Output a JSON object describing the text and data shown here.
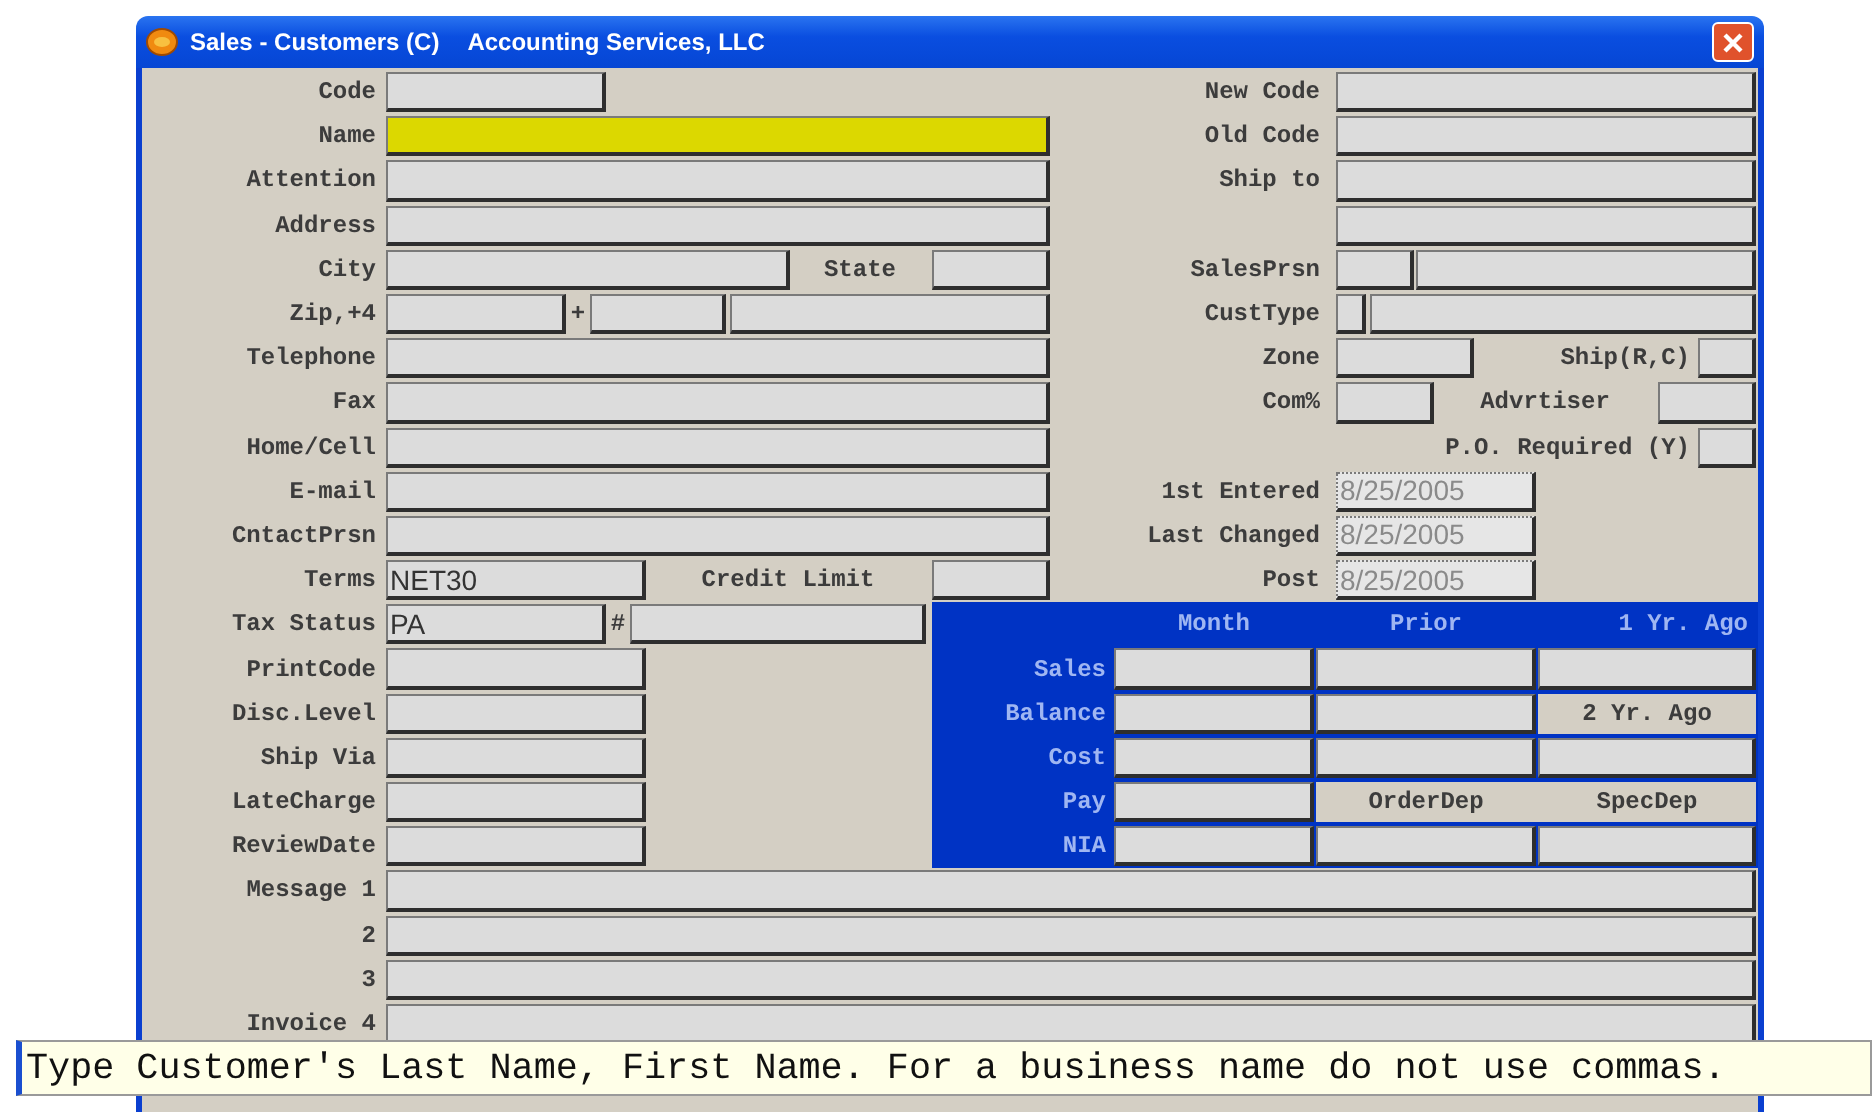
{
  "window": {
    "title": "Sales - Customers (C)",
    "company": "Accounting Services, LLC"
  },
  "left_column": [
    {
      "label": "Code",
      "focused": false
    },
    {
      "label": "Name",
      "focused": true
    },
    {
      "label": "Attention",
      "focused": false
    },
    {
      "label": "Address",
      "focused": false
    },
    {
      "label": "City",
      "extra_label": "State",
      "focused": false
    },
    {
      "label": "Zip,+4",
      "extra_label": "+",
      "focused": false
    },
    {
      "label": "Telephone",
      "focused": false
    },
    {
      "label": "Fax",
      "focused": false
    },
    {
      "label": "Home/Cell",
      "focused": false
    },
    {
      "label": "E-mail",
      "focused": false
    },
    {
      "label": "CntactPrsn",
      "focused": false
    },
    {
      "label": "Terms",
      "value": "NET30",
      "extra_label": "Credit Limit",
      "focused": false
    },
    {
      "label": "Tax Status",
      "value": "PA",
      "extra_label": "#",
      "focused": false
    },
    {
      "label": "PrintCode",
      "focused": false
    },
    {
      "label": "Disc.Level",
      "focused": false
    },
    {
      "label": "Ship Via",
      "focused": false
    },
    {
      "label": "LateCharge",
      "focused": false
    },
    {
      "label": "ReviewDate",
      "focused": false
    },
    {
      "label": "Message 1",
      "focused": false
    },
    {
      "label": "2",
      "focused": false
    },
    {
      "label": "3",
      "focused": false
    },
    {
      "label": "Invoice  4",
      "focused": false
    }
  ],
  "right_column": [
    {
      "label": "New Code",
      "disabled": false
    },
    {
      "label": "Old Code",
      "disabled": false
    },
    {
      "label": "Ship to",
      "disabled": false
    },
    {
      "disabled": false
    },
    {
      "label": "SalesPrsn",
      "disabled": false
    },
    {
      "label": "CustType",
      "disabled": false
    },
    {
      "label": "Zone",
      "extra_label": "Ship(R,C)",
      "disabled": false
    },
    {
      "label": "Com%",
      "extra_label": "Advrtiser",
      "disabled": false
    },
    {
      "extra_label": "P.O. Required (Y)",
      "disabled": false
    },
    {
      "label": "1st Entered",
      "value": "8/25/2005",
      "disabled": true
    },
    {
      "label": "Last Changed",
      "value": "8/25/2005",
      "disabled": true
    },
    {
      "label": "Post",
      "value": "8/25/2005",
      "disabled": true
    }
  ],
  "stats": {
    "columns": [
      "Month",
      "Prior",
      "1 Yr. Ago"
    ],
    "rows": [
      {
        "label": "Sales"
      },
      {
        "label": "Balance",
        "note": "2 Yr. Ago"
      },
      {
        "label": "Cost"
      },
      {
        "label": "Pay",
        "notes": [
          "OrderDep",
          "SpecDep"
        ]
      },
      {
        "label": "NIA"
      }
    ]
  },
  "hint": "Type Customer's Last Name, First Name. For a business name do not use commas."
}
